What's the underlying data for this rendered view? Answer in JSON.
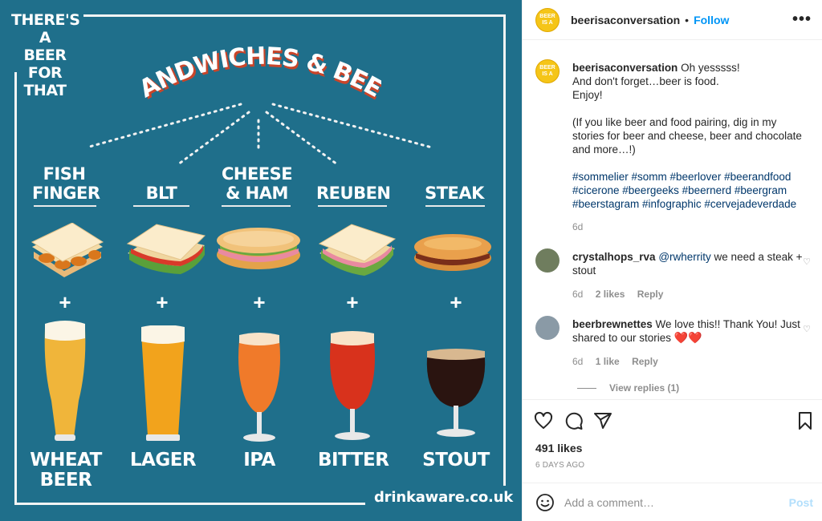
{
  "post": {
    "corner_text": [
      "THERE'S A",
      "BEER",
      "FOR THAT"
    ],
    "title": "SANDWICHES & BEER",
    "sandwiches": [
      {
        "label_lines": [
          "FISH",
          "FINGER"
        ],
        "icon": "fish-finger-sandwich-icon"
      },
      {
        "label_lines": [
          "BLT"
        ],
        "icon": "blt-sandwich-icon"
      },
      {
        "label_lines": [
          "CHEESE",
          "& HAM"
        ],
        "icon": "cheese-ham-sandwich-icon"
      },
      {
        "label_lines": [
          "REUBEN"
        ],
        "icon": "reuben-sandwich-icon"
      },
      {
        "label_lines": [
          "STEAK"
        ],
        "icon": "steak-sandwich-icon"
      }
    ],
    "plus_sign": "+",
    "beers": [
      {
        "label_lines": [
          "WHEAT",
          "BEER"
        ],
        "color": "#f0b53a",
        "icon": "wheat-beer-glass-icon"
      },
      {
        "label_lines": [
          "LAGER"
        ],
        "color": "#f2a31c",
        "icon": "lager-glass-icon"
      },
      {
        "label_lines": [
          "IPA"
        ],
        "color": "#f07a2a",
        "icon": "ipa-glass-icon"
      },
      {
        "label_lines": [
          "BITTER"
        ],
        "color": "#d8321c",
        "icon": "bitter-glass-icon"
      },
      {
        "label_lines": [
          "STOUT"
        ],
        "color": "#2a1410",
        "icon": "stout-glass-icon"
      }
    ],
    "site": "drinkaware.co.uk",
    "background_color": "#1f6f8b"
  },
  "header": {
    "username": "beerisaconversation",
    "separator": "•",
    "follow_label": "Follow",
    "more_label": "•••"
  },
  "caption": {
    "username": "beerisaconversation",
    "lines": [
      "Oh yesssss!",
      "And don't forget…beer is food.",
      "Enjoy!",
      "",
      "(If you like beer and food pairing, dig in my stories for beer and cheese, beer and chocolate and more…!)",
      ""
    ],
    "hashtags": "#sommelier #somm #beerlover #beerandfood #cicerone #beergeeks #beernerd #beergram #beerstagram #infographic #cervejadeverdade",
    "time": "6d"
  },
  "comments": [
    {
      "username": "crystalhops_rva",
      "mention": "@rwherrity",
      "text": " we need a steak + stout",
      "time": "6d",
      "likes": "2 likes",
      "reply_label": "Reply"
    },
    {
      "username": "beerbrewnettes",
      "mention": "",
      "text": " We love this!! Thank You! Just shared to our stories ",
      "emoji": "❤️❤️",
      "time": "6d",
      "likes": "1 like",
      "reply_label": "Reply",
      "view_replies": "View replies (1)"
    }
  ],
  "actions": {
    "likes": "491 likes",
    "time_ago": "6 DAYS AGO"
  },
  "add_comment": {
    "placeholder": "Add a comment…",
    "post_label": "Post"
  },
  "colors": {
    "link": "#00376b",
    "follow": "#0095f6",
    "muted": "#8e8e8e",
    "post_disabled": "#b2dffc"
  }
}
